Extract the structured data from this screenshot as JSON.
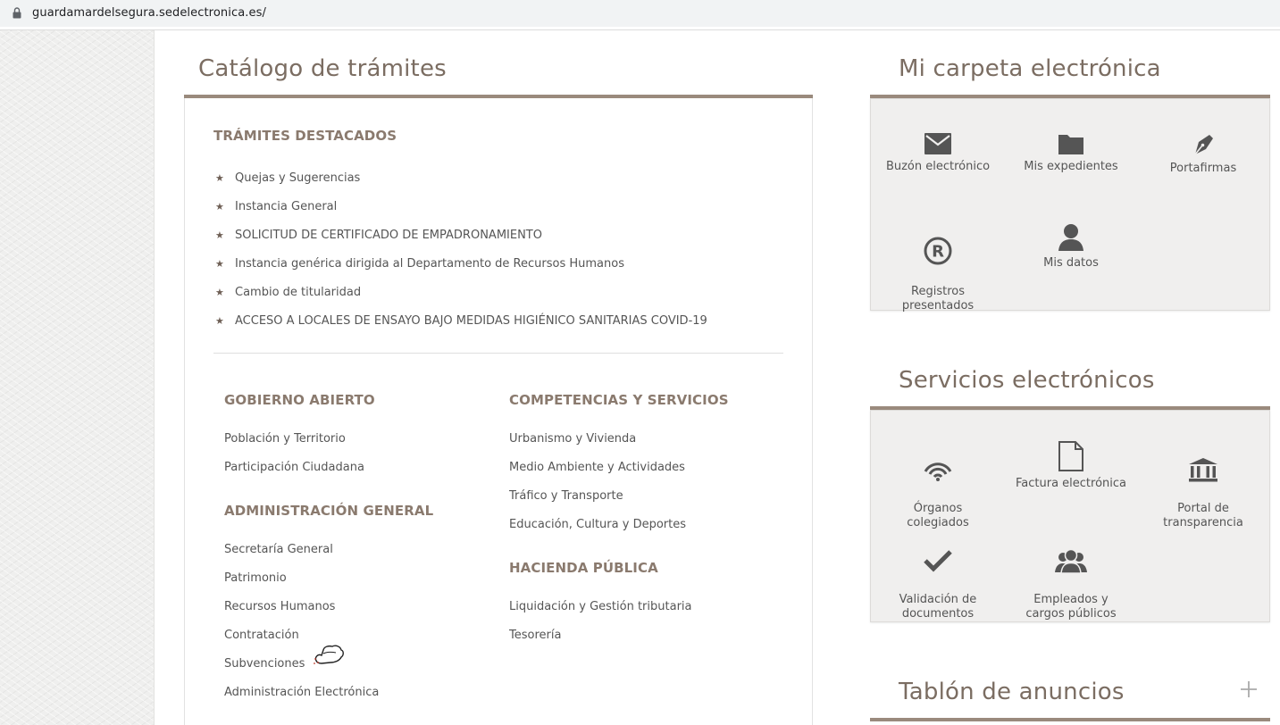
{
  "browser": {
    "url": "guardamardelsegura.sedelectronica.es/"
  },
  "catalog": {
    "title": "Catálogo de trámites",
    "featured": {
      "heading": "TRÁMITES DESTACADOS",
      "items": [
        "Quejas y Sugerencias",
        "Instancia General",
        "SOLICITUD DE CERTIFICADO DE EMPADRONAMIENTO",
        "Instancia genérica dirigida al Departamento de Recursos Humanos",
        "Cambio de titularidad",
        "ACCESO A LOCALES DE ENSAYO BAJO MEDIDAS HIGIÉNICO SANITARIAS COVID-19"
      ]
    },
    "open_government": {
      "heading": "GOBIERNO ABIERTO",
      "items": [
        "Población y Territorio",
        "Participación Ciudadana"
      ]
    },
    "general_admin": {
      "heading": "ADMINISTRACIÓN GENERAL",
      "items": [
        "Secretaría General",
        "Patrimonio",
        "Recursos Humanos",
        "Contratación",
        "Subvenciones",
        "Administración Electrónica"
      ]
    },
    "competencies": {
      "heading": "COMPETENCIAS Y SERVICIOS",
      "items": [
        "Urbanismo y Vivienda",
        "Medio Ambiente y Actividades",
        "Tráfico y Transporte",
        "Educación, Cultura y Deportes"
      ]
    },
    "treasury": {
      "heading": "HACIENDA PÚBLICA",
      "items": [
        "Liquidación y Gestión tributaria",
        "Tesorería"
      ]
    }
  },
  "folder": {
    "title": "Mi carpeta electrónica",
    "tiles": [
      {
        "label": "Buzón electrónico",
        "icon": "envelope-icon"
      },
      {
        "label": "Mis expedientes",
        "icon": "folder-icon"
      },
      {
        "label": "Portafirmas",
        "icon": "pen-nib-icon"
      },
      {
        "label": "Registros\npresentados",
        "icon": "registered-icon"
      },
      {
        "label": "Mis datos",
        "icon": "user-icon"
      }
    ]
  },
  "services": {
    "title": "Servicios electrónicos",
    "tiles": [
      {
        "label": "Órganos\ncolegiados",
        "icon": "broadcast-icon"
      },
      {
        "label": "Factura electrónica",
        "icon": "document-icon"
      },
      {
        "label": "Portal de\ntransparencia",
        "icon": "bank-icon"
      },
      {
        "label": "Validación de\ndocumentos",
        "icon": "checkmark-icon"
      },
      {
        "label": "Empleados y\ncargos públicos",
        "icon": "group-icon"
      }
    ]
  },
  "notices": {
    "title": "Tablón de anuncios",
    "expand_icon": "plus-icon"
  },
  "colors": {
    "accent": "#9a8a7d",
    "heading_text": "#8a7a6e",
    "panel_bg": "#f0efee",
    "icon": "#555555"
  }
}
